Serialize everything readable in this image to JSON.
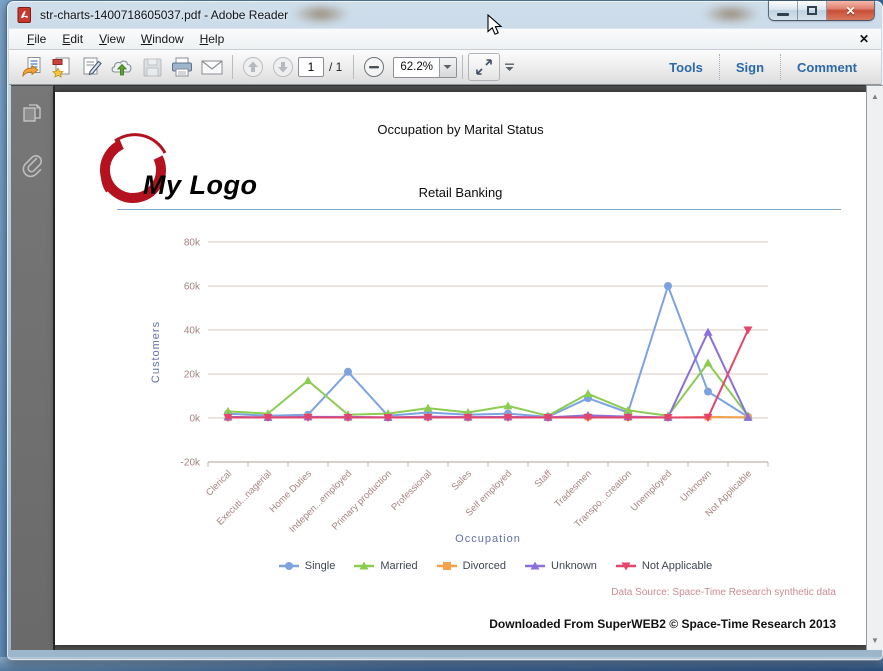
{
  "window": {
    "title": "str-charts-1400718605037.pdf - Adobe Reader"
  },
  "menu": {
    "items": [
      "File",
      "Edit",
      "View",
      "Window",
      "Help"
    ],
    "close_glyph": "✕"
  },
  "toolbar": {
    "page_current": "1",
    "page_total": "/ 1",
    "zoom_value": "62.2%",
    "buttons": [
      "Tools",
      "Sign",
      "Comment"
    ]
  },
  "document": {
    "title": "Occupation by Marital Status",
    "logo_text": "My Logo",
    "subtitle": "Retail Banking",
    "data_source": "Data Source: Space-Time Research synthetic data",
    "footer": "Downloaded From SuperWEB2 © Space-Time Research 2013"
  },
  "chart_data": {
    "type": "line",
    "title": "",
    "xlabel": "Occupation",
    "ylabel": "Customers",
    "ylim": [
      -20000,
      80000
    ],
    "y_ticks": [
      "80k",
      "60k",
      "40k",
      "20k",
      "0k",
      "-20k"
    ],
    "grid": true,
    "legend_position": "bottom",
    "categories": [
      "Clerical",
      "Executi...nagerial",
      "Home Duties",
      "Indepen...employed",
      "Primary production",
      "Professional",
      "Sales",
      "Self employed",
      "Staff",
      "Tradesmen",
      "Transpo...creation",
      "Unemployed",
      "Unknown",
      "Not Applicable"
    ],
    "series": [
      {
        "name": "Single",
        "color": "#7da2e2",
        "marker": "circle",
        "values": [
          2000,
          1000,
          1500,
          21000,
          1000,
          2500,
          1500,
          2000,
          500,
          9000,
          2500,
          60000,
          12000,
          500
        ]
      },
      {
        "name": "Married",
        "color": "#8ccc50",
        "marker": "triangle",
        "values": [
          3000,
          2000,
          17000,
          1500,
          2000,
          4500,
          2500,
          5500,
          1000,
          11000,
          3500,
          1000,
          25000,
          1000
        ]
      },
      {
        "name": "Divorced",
        "color": "#f2a14d",
        "marker": "square",
        "values": [
          300,
          300,
          500,
          300,
          200,
          400,
          300,
          400,
          200,
          500,
          300,
          200,
          500,
          300
        ]
      },
      {
        "name": "Unknown",
        "color": "#8a70d8",
        "marker": "triangle",
        "values": [
          500,
          300,
          500,
          500,
          300,
          600,
          400,
          500,
          300,
          1200,
          600,
          300,
          39000,
          300
        ]
      },
      {
        "name": "Not Applicable",
        "color": "#e5446d",
        "marker": "triangle-down",
        "values": [
          200,
          200,
          200,
          200,
          200,
          200,
          200,
          200,
          200,
          200,
          200,
          200,
          200,
          40000
        ]
      }
    ],
    "style": {
      "grid_color": "#d8cabf",
      "axis_color": "#c2b4a9",
      "tick_text": "#a5837f",
      "axis_title": "#5e71a8"
    }
  },
  "colors": {
    "accent": "#2c69a8",
    "divider": "#7fa8cf",
    "logo_red": "#b51220"
  }
}
